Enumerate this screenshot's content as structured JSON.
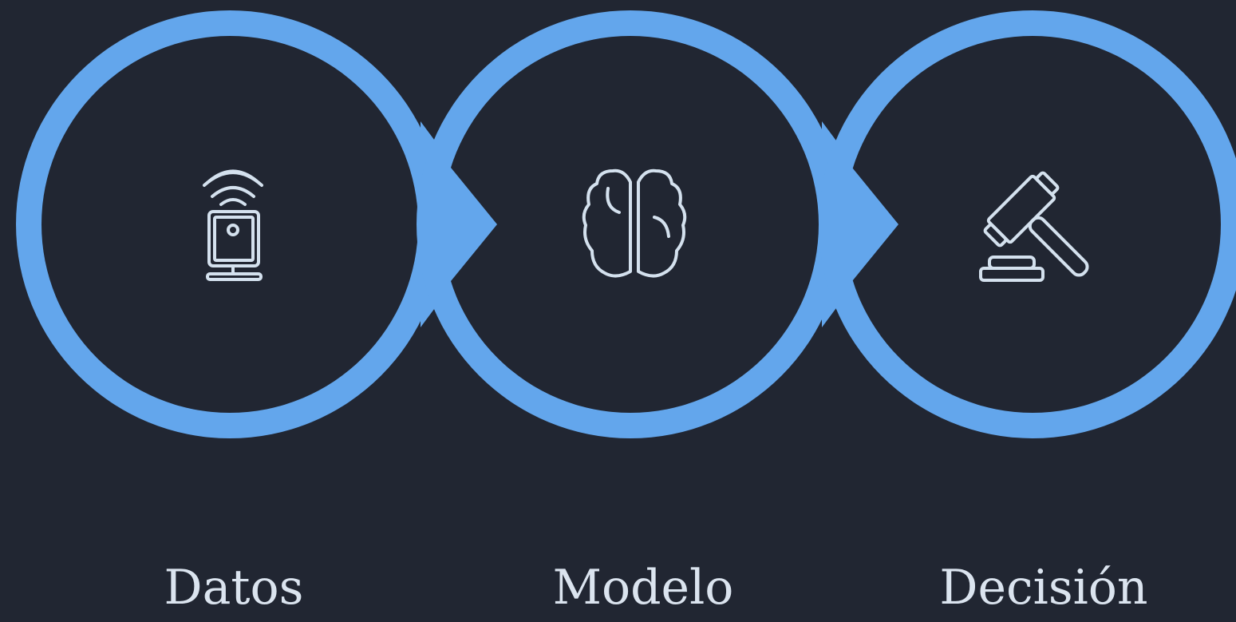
{
  "diagram": {
    "type": "process-flow",
    "colors": {
      "background": "#212632",
      "ring": "#63a6ec",
      "icon": "#d4e1ee",
      "text": "#dbe4ef"
    },
    "steps": [
      {
        "label": "Datos",
        "icon": "wireless-sensor-icon"
      },
      {
        "label": "Modelo",
        "icon": "brain-icon"
      },
      {
        "label": "Decisión",
        "icon": "gavel-icon"
      }
    ]
  }
}
